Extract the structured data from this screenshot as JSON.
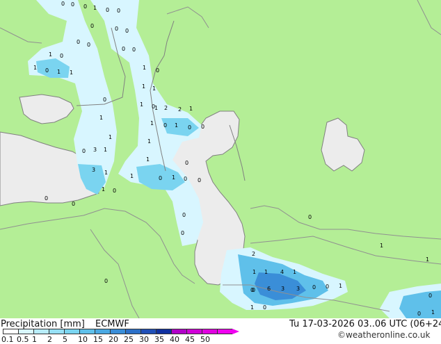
{
  "map": {
    "title_left": "Precipitation [mm]",
    "model": "ECMWF",
    "datetime": "Tu 17-03-2026 03..06 UTC (06+24)",
    "credit": "©weatheronline.co.uk",
    "colors": {
      "land": "#b4ee96",
      "water": "#ececec",
      "border": "#909090",
      "coast": "#808080"
    },
    "legend": {
      "ticks": [
        "0.1",
        "0.5",
        "1",
        "2",
        "5",
        "10",
        "15",
        "20",
        "25",
        "30",
        "35",
        "40",
        "45",
        "50"
      ],
      "colors": [
        "#ffffff",
        "#d8f6ff",
        "#b8ecfa",
        "#96e0f5",
        "#7ad4f0",
        "#5fc0ea",
        "#4aa8e2",
        "#3a8ed8",
        "#2c70c8",
        "#2050b8",
        "#1030a0",
        "#b000c8",
        "#d000d8",
        "#e000e0",
        "#f000f0"
      ]
    },
    "values": [
      {
        "label": "0"
      },
      {
        "label": "0"
      },
      {
        "label": "0"
      },
      {
        "label": "1"
      },
      {
        "label": "0"
      },
      {
        "label": "0"
      },
      {
        "label": "0"
      },
      {
        "label": "0"
      },
      {
        "label": "0"
      },
      {
        "label": "0"
      },
      {
        "label": "0"
      },
      {
        "label": "0"
      },
      {
        "label": "1"
      },
      {
        "label": "0"
      },
      {
        "label": "0"
      },
      {
        "label": "1"
      },
      {
        "label": "0"
      },
      {
        "label": "1"
      },
      {
        "label": "0"
      },
      {
        "label": "1"
      },
      {
        "label": "1"
      },
      {
        "label": "1"
      },
      {
        "label": "1"
      },
      {
        "label": "0"
      },
      {
        "label": "1"
      },
      {
        "label": "0"
      },
      {
        "label": "1"
      },
      {
        "label": "2"
      },
      {
        "label": "2"
      },
      {
        "label": "1"
      },
      {
        "label": "1"
      },
      {
        "label": "1"
      },
      {
        "label": "0"
      },
      {
        "label": "1"
      },
      {
        "label": "0"
      },
      {
        "label": "0"
      },
      {
        "label": "1"
      },
      {
        "label": "3"
      },
      {
        "label": "1"
      },
      {
        "label": "0"
      },
      {
        "label": "1"
      },
      {
        "label": "1"
      },
      {
        "label": "3"
      },
      {
        "label": "1"
      },
      {
        "label": "1"
      },
      {
        "label": "0"
      },
      {
        "label": "1"
      },
      {
        "label": "0"
      },
      {
        "label": "0"
      },
      {
        "label": "0"
      },
      {
        "label": "1"
      },
      {
        "label": "0"
      },
      {
        "label": "0"
      },
      {
        "label": "0"
      },
      {
        "label": "0"
      },
      {
        "label": "0"
      },
      {
        "label": "2"
      },
      {
        "label": "1"
      },
      {
        "label": "0"
      },
      {
        "label": "1"
      },
      {
        "label": "4"
      },
      {
        "label": "1"
      },
      {
        "label": "0"
      },
      {
        "label": "6"
      },
      {
        "label": "3"
      },
      {
        "label": "3"
      },
      {
        "label": "0"
      },
      {
        "label": "0"
      },
      {
        "label": "1"
      },
      {
        "label": "1"
      },
      {
        "label": "1"
      },
      {
        "label": "0"
      },
      {
        "label": "0"
      },
      {
        "label": "0"
      },
      {
        "label": "0"
      },
      {
        "label": "1"
      },
      {
        "label": "0"
      },
      {
        "label": "1"
      }
    ]
  }
}
